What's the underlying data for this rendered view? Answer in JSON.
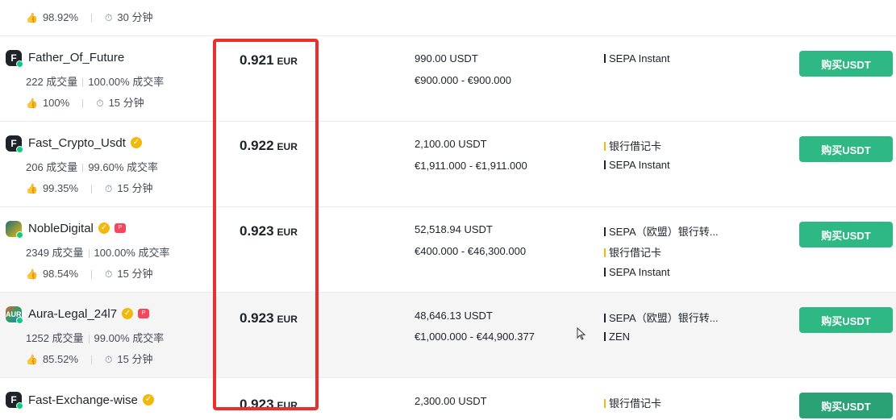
{
  "partial_top": {
    "completion": "98.92%",
    "pay_time": "30 分钟"
  },
  "rows": [
    {
      "avatar": "F",
      "name": "Father_Of_Future",
      "orders": "222 成交量",
      "completion": "100.00% 成交率",
      "positive": "100%",
      "pay_time": "15 分钟",
      "price": "0.921",
      "currency": "EUR",
      "available": "990.00 USDT",
      "limit": "€900.000 - €900.000",
      "payments": [
        {
          "label": "SEPA Instant",
          "color": "#1e2329"
        }
      ],
      "buy_label": "购买USDT"
    },
    {
      "avatar": "F",
      "name": "Fast_Crypto_Usdt",
      "orders": "206 成交量",
      "completion": "99.60% 成交率",
      "positive": "99.35%",
      "pay_time": "15 分钟",
      "price": "0.922",
      "currency": "EUR",
      "available": "2,100.00 USDT",
      "limit": "€1,911.000 - €1,911.000",
      "payments": [
        {
          "label": "银行借记卡",
          "color": "#f0b90b"
        },
        {
          "label": "SEPA Instant",
          "color": "#1e2329"
        }
      ],
      "buy_label": "购买USDT"
    },
    {
      "avatar": "",
      "name": "NobleDigital",
      "orders": "2349 成交量",
      "completion": "100.00% 成交率",
      "positive": "98.54%",
      "pay_time": "15 分钟",
      "price": "0.923",
      "currency": "EUR",
      "available": "52,518.94 USDT",
      "limit": "€400.000 - €46,300.000",
      "payments": [
        {
          "label": "SEPA（欧盟）银行转...",
          "color": "#1e2329"
        },
        {
          "label": "银行借记卡",
          "color": "#f0b90b"
        },
        {
          "label": "SEPA Instant",
          "color": "#1e2329"
        }
      ],
      "buy_label": "购买USDT"
    },
    {
      "avatar": "AURA",
      "name": "Aura-Legal_24l7",
      "orders": "1252 成交量",
      "completion": "99.00% 成交率",
      "positive": "85.52%",
      "pay_time": "15 分钟",
      "price": "0.923",
      "currency": "EUR",
      "available": "48,646.13 USDT",
      "limit": "€1,000.000 - €44,900.377",
      "payments": [
        {
          "label": "SEPA（欧盟）银行转...",
          "color": "#1e2329"
        },
        {
          "label": "ZEN",
          "color": "#1e2329"
        }
      ],
      "buy_label": "购买USDT"
    },
    {
      "avatar": "F",
      "name": "Fast-Exchange-wise",
      "orders": "",
      "completion": "",
      "positive": "",
      "pay_time": "",
      "price": "0.923",
      "currency": "EUR",
      "available": "2,300.00 USDT",
      "limit": "",
      "payments": [
        {
          "label": "银行借记卡",
          "color": "#f0b90b"
        }
      ],
      "buy_label": "购买USDT"
    }
  ],
  "icons": {
    "thumb": "thumbs-up-icon",
    "timer": "stopwatch-icon",
    "verified": "verified-check-icon",
    "pro": "pro-badge-icon"
  },
  "colors": {
    "buy_button": "#2eb883",
    "highlight": "#e8312f",
    "verified": "#f0b90b"
  }
}
